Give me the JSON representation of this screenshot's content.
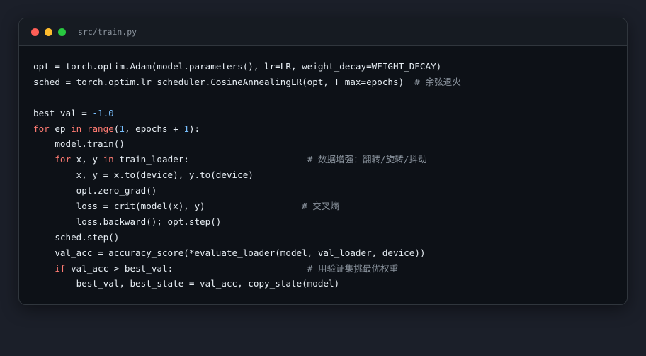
{
  "window": {
    "title": "src/train.py",
    "traffic_lights": [
      {
        "name": "close",
        "color": "#ff5f57"
      },
      {
        "name": "minimize",
        "color": "#febc2e"
      },
      {
        "name": "maximize",
        "color": "#28c840"
      }
    ]
  },
  "code": {
    "lines": [
      [
        {
          "t": "opt = torch.optim.Adam(model.parameters(), lr=LR, weight_decay=WEIGHT_DECAY)",
          "c": "pl"
        }
      ],
      [
        {
          "t": "sched = torch.optim.lr_scheduler.CosineAnnealingLR(opt, T_max=epochs)  ",
          "c": "pl"
        },
        {
          "t": "# 余弦退火",
          "c": "com"
        }
      ],
      [],
      [
        {
          "t": "best_val = ",
          "c": "pl"
        },
        {
          "t": "-1.0",
          "c": "num"
        }
      ],
      [
        {
          "t": "for",
          "c": "kw"
        },
        {
          "t": " ep ",
          "c": "pl"
        },
        {
          "t": "in",
          "c": "kw"
        },
        {
          "t": " ",
          "c": "pl"
        },
        {
          "t": "range",
          "c": "kw"
        },
        {
          "t": "(",
          "c": "pl"
        },
        {
          "t": "1",
          "c": "num"
        },
        {
          "t": ", epochs + ",
          "c": "pl"
        },
        {
          "t": "1",
          "c": "num"
        },
        {
          "t": "):",
          "c": "pl"
        }
      ],
      [
        {
          "t": "    model.train()",
          "c": "pl"
        }
      ],
      [
        {
          "t": "    ",
          "c": "pl"
        },
        {
          "t": "for",
          "c": "kw"
        },
        {
          "t": " x, y ",
          "c": "pl"
        },
        {
          "t": "in",
          "c": "kw"
        },
        {
          "t": " train_loader:                      ",
          "c": "pl"
        },
        {
          "t": "# 数据增强：翻转/旋转/抖动",
          "c": "com"
        }
      ],
      [
        {
          "t": "        x, y = x.to(device), y.to(device)",
          "c": "pl"
        }
      ],
      [
        {
          "t": "        opt.zero_grad()",
          "c": "pl"
        }
      ],
      [
        {
          "t": "        loss = crit(model(x), y)                  ",
          "c": "pl"
        },
        {
          "t": "# 交叉熵",
          "c": "com"
        }
      ],
      [
        {
          "t": "        loss.backward(); opt.step()",
          "c": "pl"
        }
      ],
      [
        {
          "t": "    sched.step()",
          "c": "pl"
        }
      ],
      [
        {
          "t": "    val_acc = accuracy_score(*evaluate_loader(model, val_loader, device))",
          "c": "pl"
        }
      ],
      [
        {
          "t": "    ",
          "c": "pl"
        },
        {
          "t": "if",
          "c": "kw"
        },
        {
          "t": " val_acc > best_val:                         ",
          "c": "pl"
        },
        {
          "t": "# 用验证集挑最优权重",
          "c": "com"
        }
      ],
      [
        {
          "t": "        best_val, best_state = val_acc, copy_state(model)",
          "c": "pl"
        }
      ]
    ]
  }
}
